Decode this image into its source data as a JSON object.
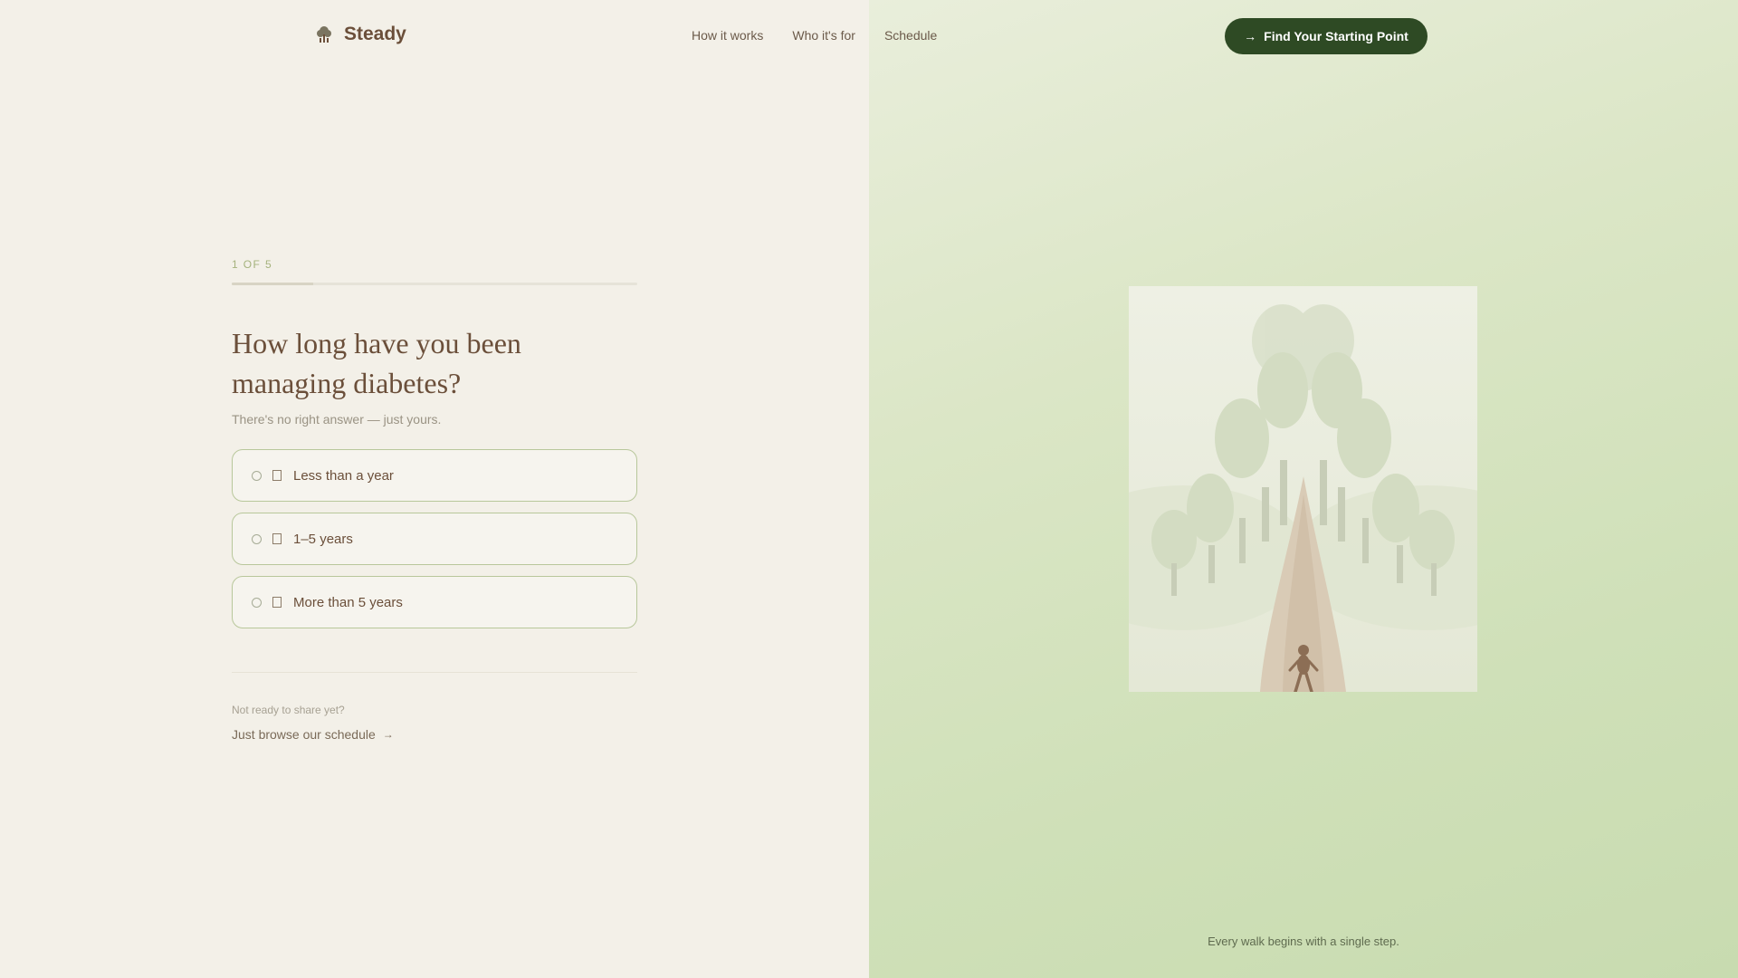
{
  "brand": {
    "name": "Steady",
    "icon": "tree-logo-icon"
  },
  "nav": {
    "items": [
      {
        "label": "How it works"
      },
      {
        "label": "Who it's for"
      },
      {
        "label": "Schedule"
      }
    ]
  },
  "cta": {
    "label": "Find Your Starting Point",
    "icon": "arrow-right-icon"
  },
  "quiz": {
    "step_label": "1 OF 5",
    "progress": 0.2,
    "question": "How long have you been managing diabetes?",
    "subtitle": "There's no right answer — just yours.",
    "options": [
      {
        "label": "Less than a year"
      },
      {
        "label": "1–5 years"
      },
      {
        "label": "More than 5 years"
      }
    ]
  },
  "aside": {
    "note": "Not ready to share yet?",
    "link_label": "Just browse our schedule",
    "link_icon": "arrow-right-icon"
  },
  "visual": {
    "caption": "Every walk begins with a single step."
  },
  "colors": {
    "accent": "#2e4a24",
    "brand_text": "#6b4f3a",
    "option_border": "#b8c79b"
  }
}
